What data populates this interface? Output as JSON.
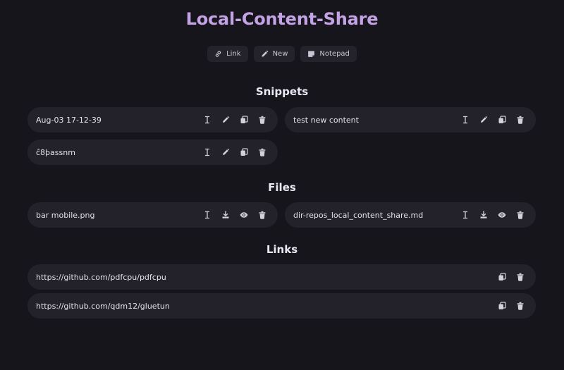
{
  "header": {
    "title": "Local-Content-Share"
  },
  "toolbar": {
    "link_label": "Link",
    "new_label": "New",
    "notepad_label": "Notepad"
  },
  "sections": {
    "snippets": "Snippets",
    "files": "Files",
    "links": "Links"
  },
  "snippets": [
    {
      "text": "Aug-03 17-12-39"
    },
    {
      "text": "test new content"
    },
    {
      "text": "ĉ8þassnm"
    }
  ],
  "files": [
    {
      "name": "bar mobile.png"
    },
    {
      "name": "dir-repos_local_content_share.md"
    }
  ],
  "links": [
    {
      "url": "https://github.com/pdfcpu/pdfcpu"
    },
    {
      "url": "https://github.com/qdm12/gluetun"
    }
  ],
  "colors": {
    "background": "#16151c",
    "card": "#23222b",
    "accent": "#c3a3e4",
    "icon": "#d2d0db"
  }
}
